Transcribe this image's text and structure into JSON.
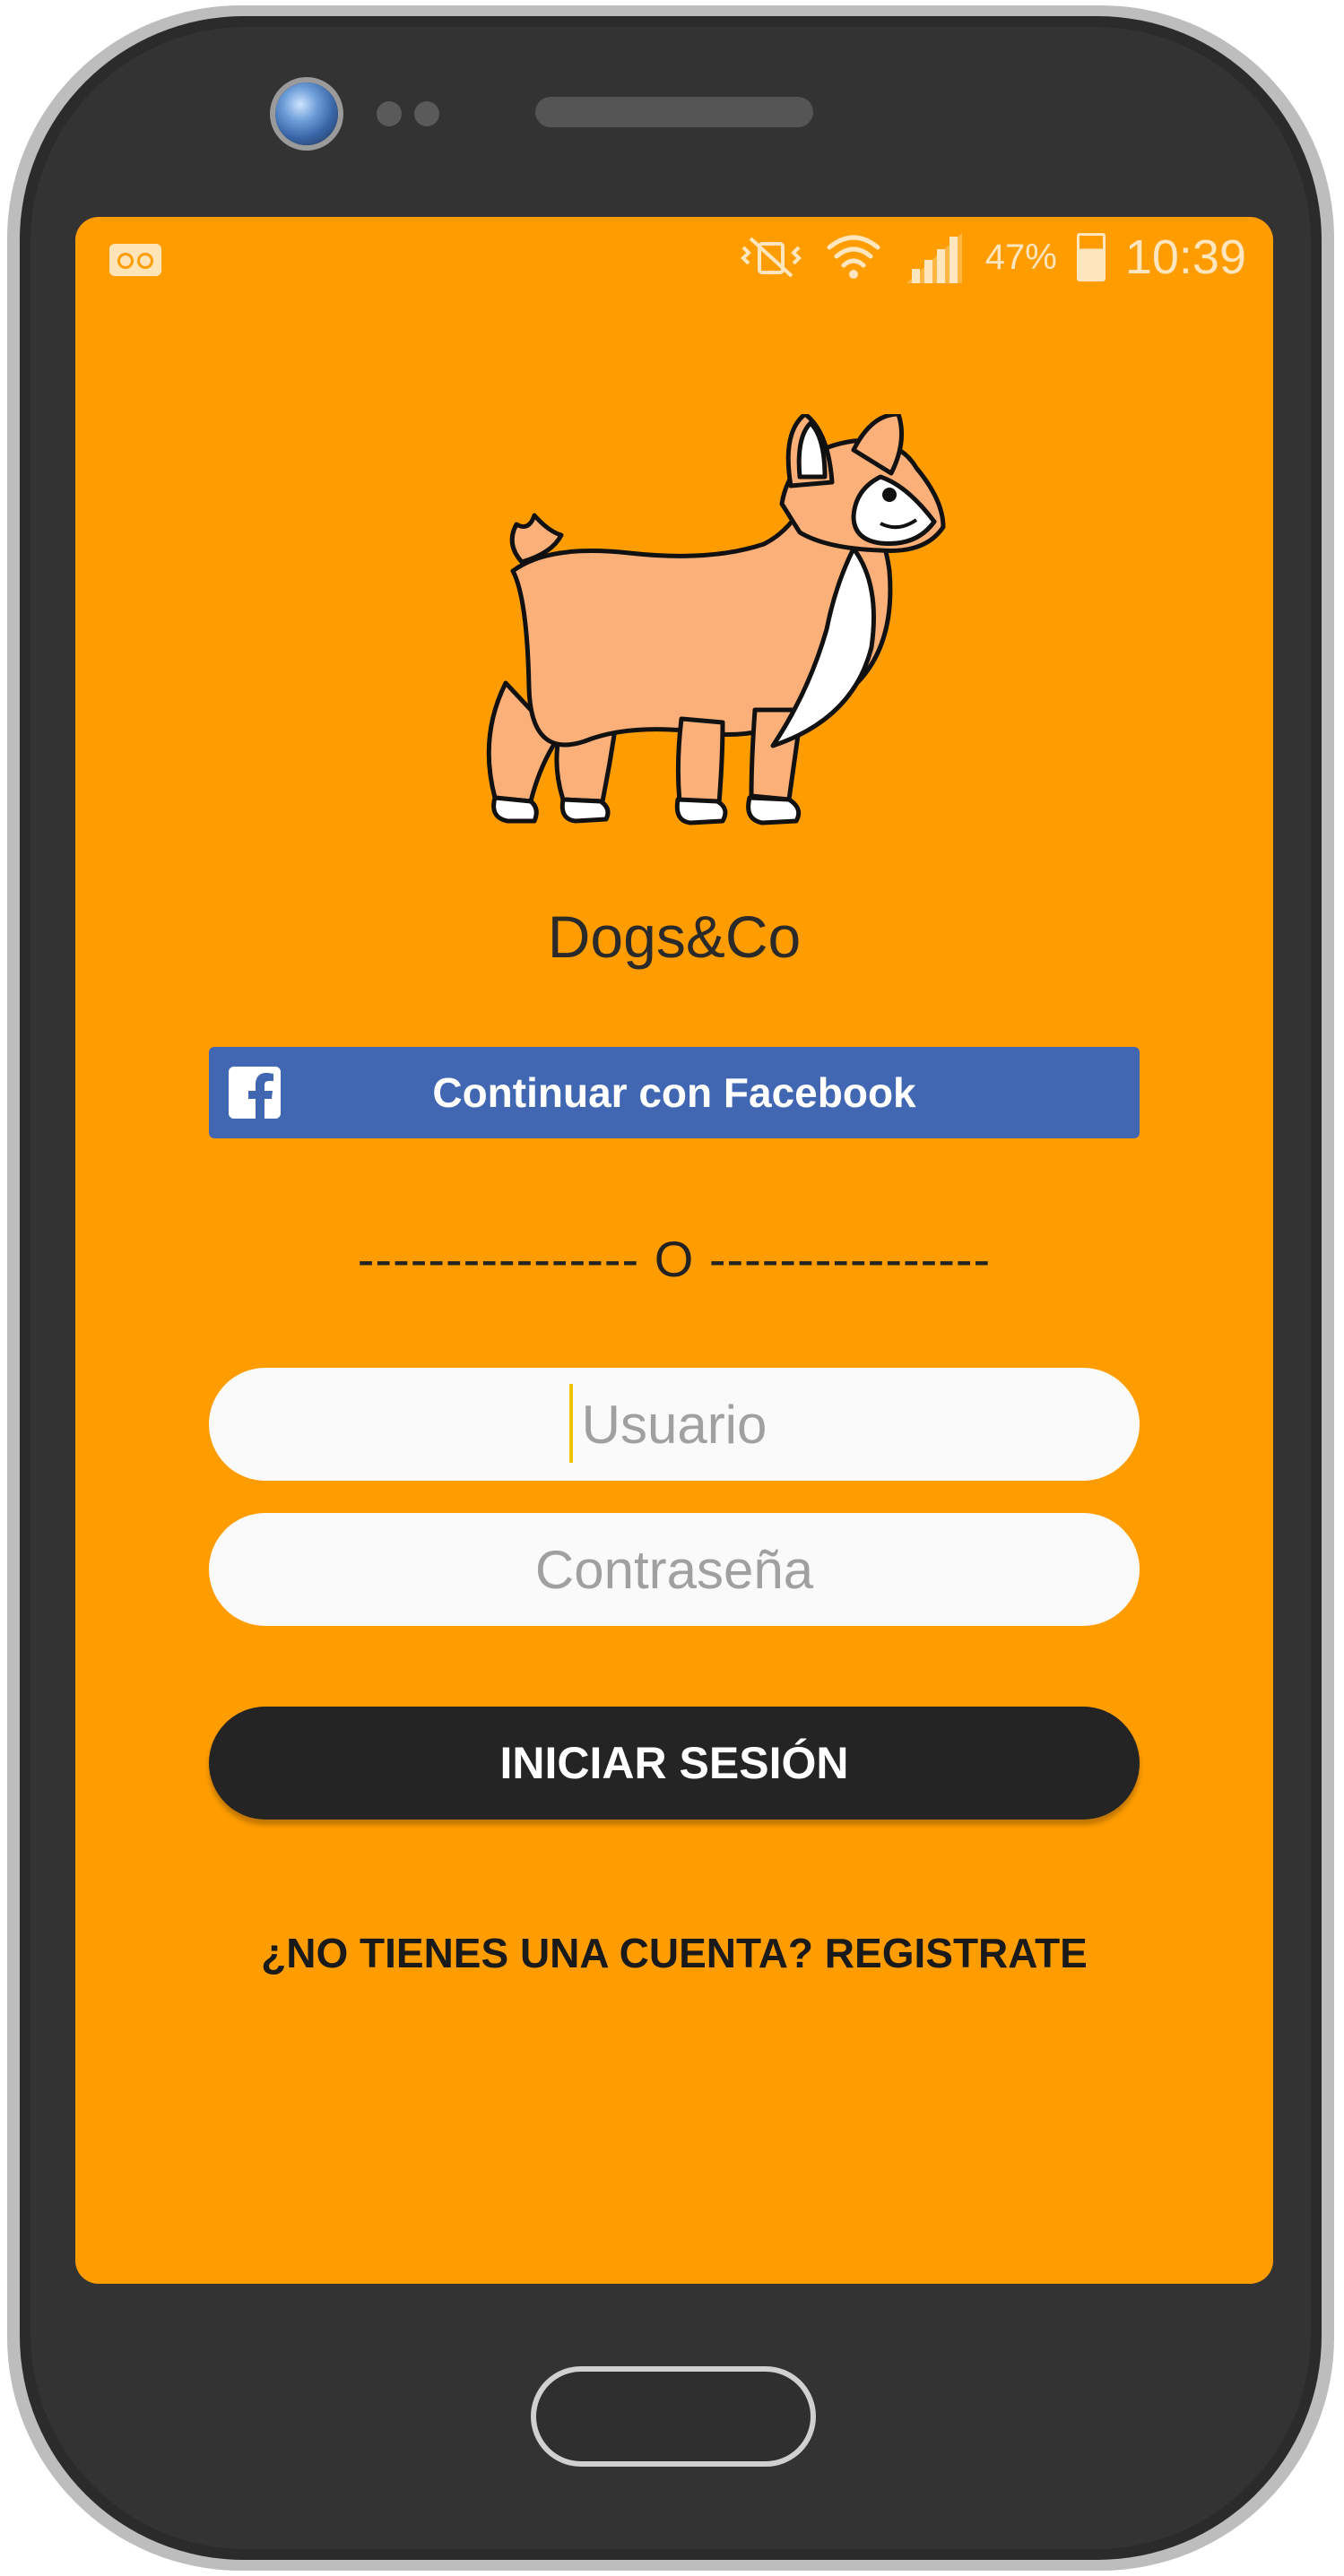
{
  "status_bar": {
    "left_icons": [
      "voicemail-icon"
    ],
    "right_icons": [
      "vibrate-mute-icon",
      "wifi-icon",
      "signal-icon",
      "battery-icon"
    ],
    "battery_percent": "47%",
    "time": "10:39"
  },
  "app": {
    "name": "Dogs&Co",
    "logo": "corgi-illustration"
  },
  "facebook_button": {
    "label": "Continuar con Facebook",
    "icon": "facebook-icon",
    "color": "#4267b2"
  },
  "divider": {
    "text": "---------------- O ----------------"
  },
  "form": {
    "username": {
      "placeholder": "Usuario",
      "value": ""
    },
    "password": {
      "placeholder": "Contraseña",
      "value": ""
    }
  },
  "login_button": {
    "label": "INICIAR SESIÓN"
  },
  "register_link": {
    "label": "¿NO TIENES UNA CUENTA? REGISTRATE"
  },
  "colors": {
    "background": "#ff9d00",
    "button_dark": "#242424"
  }
}
